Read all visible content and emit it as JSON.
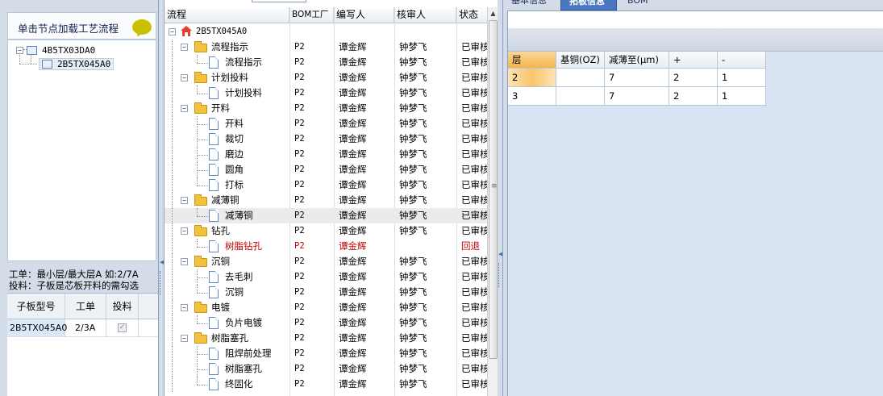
{
  "left": {
    "header": "单击节点加载工艺流程",
    "tree": [
      {
        "label": "4B5TX03DA0"
      },
      {
        "label": "2B5TX045A0"
      }
    ],
    "info": {
      "line1": "工单：最小层/最大层A 如:2/7A",
      "line2": "投料：子板是芯板开料的需勾选"
    },
    "grid": {
      "headers": [
        "子板型号",
        "工单",
        "投料"
      ],
      "row": {
        "model": "2B5TX045A0",
        "order": "2/3A",
        "feed_checked": true
      }
    }
  },
  "middle": {
    "headers": [
      "流程",
      "BOM工厂",
      "编写人",
      "核审人",
      "状态"
    ],
    "root": "2B5TX045A0",
    "rows": [
      {
        "label": "流程指示",
        "kind": "folder",
        "bom": "P2",
        "writer": "谭金辉",
        "reviewer": "钟梦飞",
        "status": "已审核"
      },
      {
        "label": "流程指示",
        "kind": "doc",
        "bom": "P2",
        "writer": "谭金辉",
        "reviewer": "钟梦飞",
        "status": "已审核"
      },
      {
        "label": "计划投料",
        "kind": "folder",
        "bom": "P2",
        "writer": "谭金辉",
        "reviewer": "钟梦飞",
        "status": "已审核"
      },
      {
        "label": "计划投料",
        "kind": "doc",
        "bom": "P2",
        "writer": "谭金辉",
        "reviewer": "钟梦飞",
        "status": "已审核"
      },
      {
        "label": "开料",
        "kind": "folder",
        "bom": "P2",
        "writer": "谭金辉",
        "reviewer": "钟梦飞",
        "status": "已审核"
      },
      {
        "label": "开料",
        "kind": "doc",
        "bom": "P2",
        "writer": "谭金辉",
        "reviewer": "钟梦飞",
        "status": "已审核"
      },
      {
        "label": "裁切",
        "kind": "doc",
        "bom": "P2",
        "writer": "谭金辉",
        "reviewer": "钟梦飞",
        "status": "已审核"
      },
      {
        "label": "磨边",
        "kind": "doc",
        "bom": "P2",
        "writer": "谭金辉",
        "reviewer": "钟梦飞",
        "status": "已审核"
      },
      {
        "label": "圆角",
        "kind": "doc",
        "bom": "P2",
        "writer": "谭金辉",
        "reviewer": "钟梦飞",
        "status": "已审核"
      },
      {
        "label": "打标",
        "kind": "doc",
        "bom": "P2",
        "writer": "谭金辉",
        "reviewer": "钟梦飞",
        "status": "已审核"
      },
      {
        "label": "减薄铜",
        "kind": "folder",
        "bom": "P2",
        "writer": "谭金辉",
        "reviewer": "钟梦飞",
        "status": "已审核"
      },
      {
        "label": "减薄铜",
        "kind": "doc",
        "bom": "P2",
        "writer": "谭金辉",
        "reviewer": "钟梦飞",
        "status": "已审核",
        "selected": true
      },
      {
        "label": "钻孔",
        "kind": "folder",
        "bom": "P2",
        "writer": "谭金辉",
        "reviewer": "钟梦飞",
        "status": "已审核"
      },
      {
        "label": "树脂钻孔",
        "kind": "doc",
        "bom": "P2",
        "writer": "谭金辉",
        "reviewer": "",
        "status": "回退",
        "red": true
      },
      {
        "label": "沉铜",
        "kind": "folder",
        "bom": "P2",
        "writer": "谭金辉",
        "reviewer": "钟梦飞",
        "status": "已审核"
      },
      {
        "label": "去毛刺",
        "kind": "doc",
        "bom": "P2",
        "writer": "谭金辉",
        "reviewer": "钟梦飞",
        "status": "已审核"
      },
      {
        "label": "沉铜",
        "kind": "doc",
        "bom": "P2",
        "writer": "谭金辉",
        "reviewer": "钟梦飞",
        "status": "已审核"
      },
      {
        "label": "电镀",
        "kind": "folder",
        "bom": "P2",
        "writer": "谭金辉",
        "reviewer": "钟梦飞",
        "status": "已审核"
      },
      {
        "label": "负片电镀",
        "kind": "doc",
        "bom": "P2",
        "writer": "谭金辉",
        "reviewer": "钟梦飞",
        "status": "已审核"
      },
      {
        "label": "树脂塞孔",
        "kind": "folder",
        "bom": "P2",
        "writer": "谭金辉",
        "reviewer": "钟梦飞",
        "status": "已审核"
      },
      {
        "label": "阻焊前处理",
        "kind": "doc",
        "bom": "P2",
        "writer": "谭金辉",
        "reviewer": "钟梦飞",
        "status": "已审核"
      },
      {
        "label": "树脂塞孔",
        "kind": "doc",
        "bom": "P2",
        "writer": "谭金辉",
        "reviewer": "钟梦飞",
        "status": "已审核"
      },
      {
        "label": "终固化",
        "kind": "doc",
        "bom": "P2",
        "writer": "谭金辉",
        "reviewer": "钟梦飞",
        "status": "已审核"
      }
    ]
  },
  "right": {
    "tabs": [
      "基本信息",
      "拓板信息",
      "BOM"
    ],
    "active_tab": 1,
    "grid": {
      "headers": [
        "层",
        "基铜(OZ)",
        "减薄至(μm)",
        "+",
        "-"
      ],
      "rows": [
        [
          "2",
          "",
          "7",
          "2",
          "1"
        ],
        [
          "3",
          "",
          "7",
          "2",
          "1"
        ]
      ]
    }
  },
  "colors": {
    "accent_tab": "#4a78c0",
    "panel_bg": "#d4dce8",
    "reject_red": "#c00000"
  }
}
